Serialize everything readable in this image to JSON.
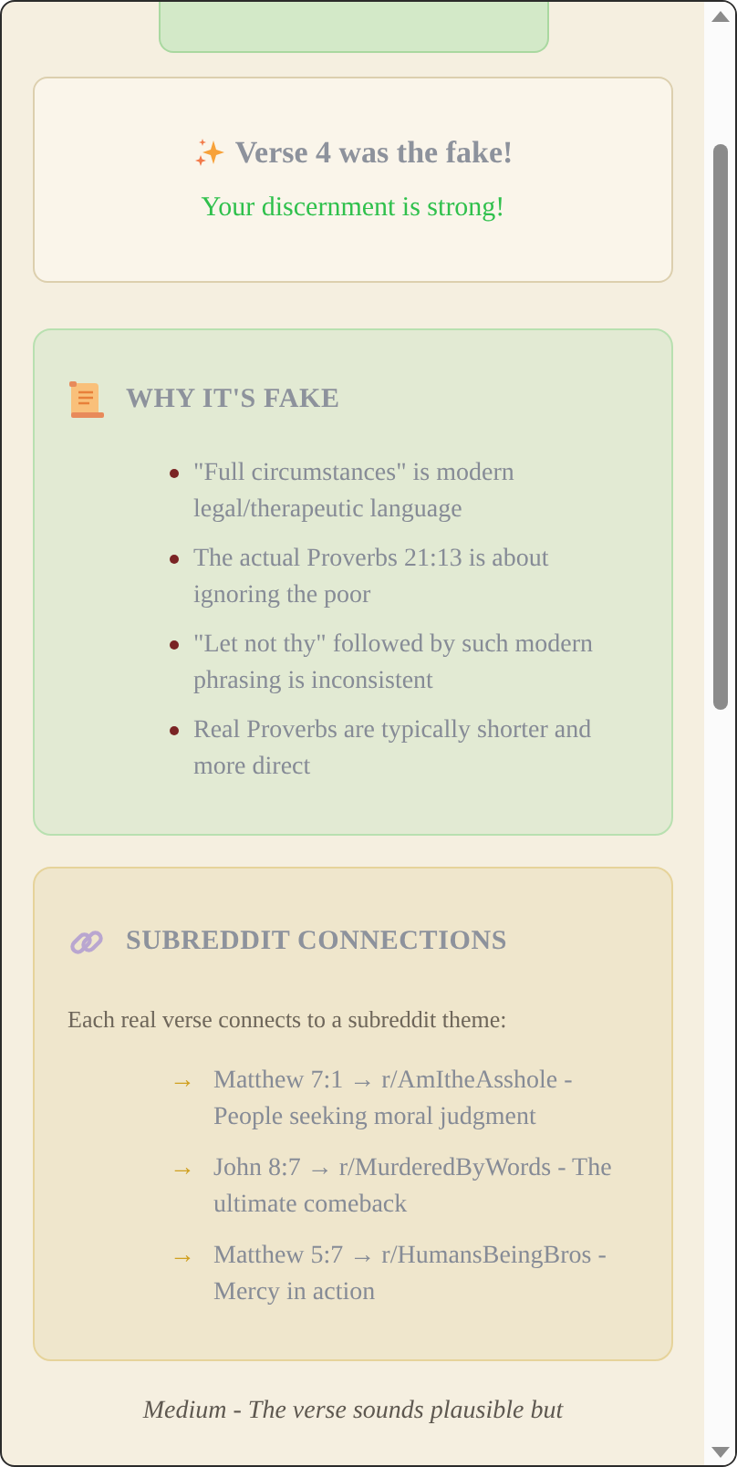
{
  "result": {
    "title": "Verse 4 was the fake!",
    "message": "Your discernment is strong!"
  },
  "why_fake": {
    "title": "WHY IT'S FAKE",
    "points": [
      "\"Full circumstances\" is modern legal/therapeutic language",
      "The actual Proverbs 21:13 is about ignoring the poor",
      "\"Let not thy\" followed by such modern phrasing is inconsistent",
      "Real Proverbs are typically shorter and more direct"
    ]
  },
  "connections": {
    "title": "SUBREDDIT CONNECTIONS",
    "intro": "Each real verse connects to a subreddit theme:",
    "arrow": "→",
    "items": [
      "Matthew 7:1 → r/AmItheAsshole - People seeking moral judgment",
      "John 8:7 → r/MurderedByWords - The ultimate comeback",
      "Matthew 5:7 → r/HumansBeingBros - Mercy in action"
    ]
  },
  "difficulty": {
    "text": "Medium - The verse sounds plausible but"
  }
}
